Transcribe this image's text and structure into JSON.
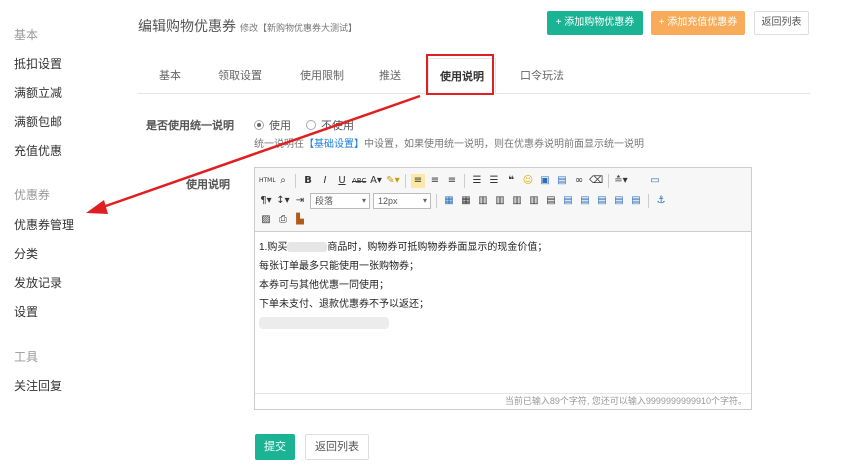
{
  "sidebar": {
    "sections": [
      {
        "heading": "基本",
        "items": [
          "抵扣设置",
          "满额立减",
          "满额包邮",
          "充值优惠"
        ]
      },
      {
        "heading": "优惠券",
        "items": [
          "优惠券管理",
          "分类",
          "发放记录",
          "设置"
        ]
      },
      {
        "heading": "工具",
        "items": [
          "关注回复"
        ]
      }
    ]
  },
  "header": {
    "title": "编辑购物优惠券",
    "subtitle": "修改【新购物优惠券大测试】",
    "btn_add_shopping": "+ 添加购物优惠券",
    "btn_add_recharge": "+ 添加充值优惠券",
    "btn_back_list": "返回列表"
  },
  "tabs": [
    "基本",
    "领取设置",
    "使用限制",
    "推送",
    "使用说明",
    "口令玩法"
  ],
  "active_tab": "使用说明",
  "form": {
    "unified_label": "是否使用统一说明",
    "option_use": "使用",
    "option_not_use": "不使用",
    "hint_prefix": "统一说明在",
    "hint_link": "【基础设置】",
    "hint_suffix": "中设置，如果使用统一说明，则在优惠券说明前面显示统一说明",
    "usage_label": "使用说明"
  },
  "editor": {
    "paragraph_select": "段落",
    "fontsize_select": "12px",
    "lines": [
      {
        "before": "1.购买",
        "after": "商品时，购物券可抵购物券券面显示的现金价值；"
      },
      {
        "before": "每张订单最多只能使用一张购物券；",
        "after": ""
      },
      {
        "before": "本券可与其他优惠一同使用；",
        "after": ""
      },
      {
        "before": "下单未支付、退款优惠券不予以返还；",
        "after": ""
      }
    ],
    "counter": "当前已输入89个字符, 您还可以输入9999999999910个字符。"
  },
  "footer": {
    "submit": "提交",
    "back": "返回列表"
  },
  "colors": {
    "primary_green": "#1ab394",
    "orange": "#f8ac59",
    "highlight_red": "#e02020",
    "link_blue": "#1d7dd8"
  }
}
